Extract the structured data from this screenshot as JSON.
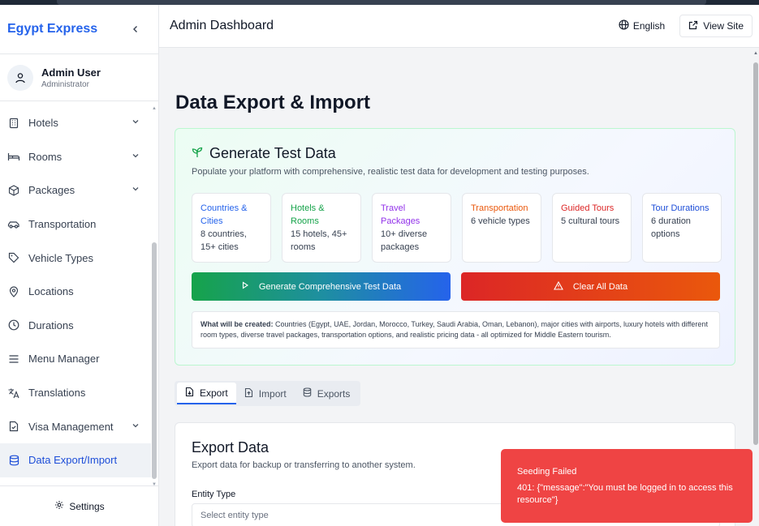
{
  "sidebar": {
    "brand": "Egypt Express",
    "user": {
      "name": "Admin User",
      "role": "Administrator"
    },
    "items": [
      {
        "label": "Hotels"
      },
      {
        "label": "Rooms"
      },
      {
        "label": "Packages"
      },
      {
        "label": "Transportation"
      },
      {
        "label": "Vehicle Types"
      },
      {
        "label": "Locations"
      },
      {
        "label": "Durations"
      },
      {
        "label": "Menu Manager"
      },
      {
        "label": "Translations"
      },
      {
        "label": "Visa Management"
      },
      {
        "label": "Data Export/Import"
      }
    ],
    "settings_label": "Settings"
  },
  "header": {
    "title": "Admin Dashboard",
    "language": "English",
    "view_site": "View Site"
  },
  "main": {
    "page_title": "Data Export & Import",
    "generate": {
      "title": "Generate Test Data",
      "description": "Populate your platform with comprehensive, realistic test data for development and testing purposes.",
      "stats": [
        {
          "title": "Countries & Cities",
          "desc": "8 countries, 15+ cities",
          "color": "#2563eb"
        },
        {
          "title": "Hotels & Rooms",
          "desc": "15 hotels, 45+ rooms",
          "color": "#16a34a"
        },
        {
          "title": "Travel Packages",
          "desc": "10+ diverse packages",
          "color": "#9333ea"
        },
        {
          "title": "Transportation",
          "desc": "6 vehicle types",
          "color": "#ea580c"
        },
        {
          "title": "Guided Tours",
          "desc": "5 cultural tours",
          "color": "#dc2626"
        },
        {
          "title": "Tour Durations",
          "desc": "6 duration options",
          "color": "#1d4ed8"
        }
      ],
      "generate_button": "Generate Comprehensive Test Data",
      "clear_button": "Clear All Data",
      "note_label": "What will be created:",
      "note_text": " Countries (Egypt, UAE, Jordan, Morocco, Turkey, Saudi Arabia, Oman, Lebanon), major cities with airports, luxury hotels with different room types, diverse travel packages, transportation options, and realistic pricing data - all optimized for Middle Eastern tourism."
    },
    "tabs": [
      {
        "label": "Export"
      },
      {
        "label": "Import"
      },
      {
        "label": "Exports"
      }
    ],
    "export": {
      "title": "Export Data",
      "description": "Export data for backup or transferring to another system.",
      "entity_label": "Entity Type",
      "entity_placeholder": "Select entity type"
    }
  },
  "toast": {
    "title": "Seeding Failed",
    "message": "401: {\"message\":\"You must be logged in to access this resource\"}"
  }
}
